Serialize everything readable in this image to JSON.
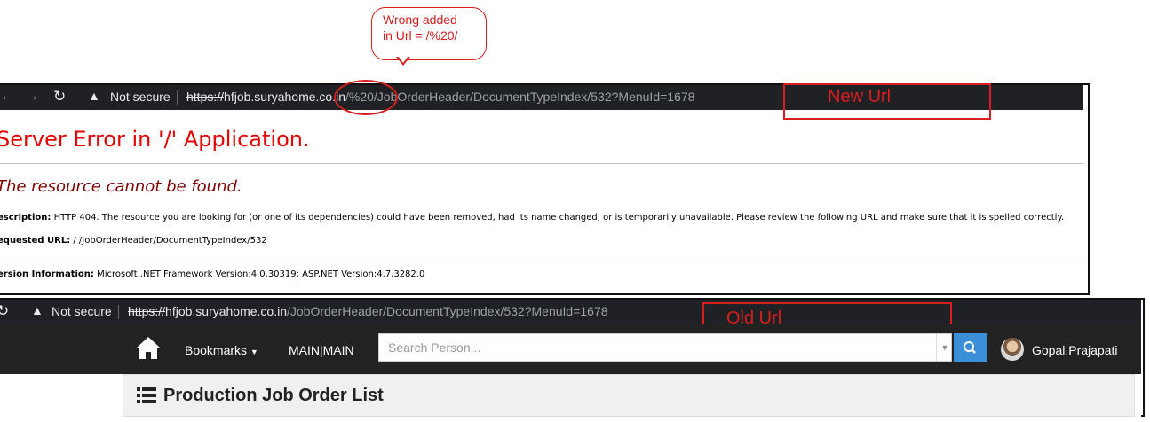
{
  "annotation": {
    "callout_text": "Wrong added\nin Url = /%20/",
    "new_url_label": "New Url",
    "old_url_label": "Old Url"
  },
  "new_browser": {
    "security_label": "Not secure",
    "url_scheme": "https://",
    "url_host": "hfjob.suryahome.co.in",
    "url_path": "/%20/JobOrderHeader/DocumentTypeIndex/532?MenuId=1678"
  },
  "error_page": {
    "title": "Server Error in '/' Application.",
    "subtitle": "The resource cannot be found.",
    "description_label": "escription:",
    "description_text": "HTTP 404. The resource you are looking for (or one of its dependencies) could have been removed, had its name changed, or is temporarily unavailable.  Please review the following URL and make sure that it is spelled correctly.",
    "requested_url_label": "equested URL:",
    "requested_url_value": "/ /JobOrderHeader/DocumentTypeIndex/532",
    "version_label": "ersion Information:",
    "version_value": "Microsoft .NET Framework Version:4.0.30319; ASP.NET Version:4.7.3282.0"
  },
  "old_browser": {
    "security_label": "Not secure",
    "url_scheme": "https://",
    "url_host": "hfjob.suryahome.co.in",
    "url_path": "/JobOrderHeader/DocumentTypeIndex/532?MenuId=1678"
  },
  "navbar": {
    "bookmarks_label": "Bookmarks",
    "main_label": "MAIN|MAIN",
    "search_placeholder": "Search Person...",
    "user_name": "Gopal.Prajapati"
  },
  "panel": {
    "title": "Production Job Order List"
  },
  "icons": [
    "back-arrow-icon",
    "forward-arrow-icon",
    "reload-icon",
    "warning-icon",
    "home-icon",
    "caret-down-icon",
    "search-icon",
    "list-icon"
  ],
  "colors": {
    "annotation_red": "#d81e1e",
    "error_red": "#e60000",
    "error_maroon": "#800000",
    "search_blue": "#3a8fd6"
  }
}
